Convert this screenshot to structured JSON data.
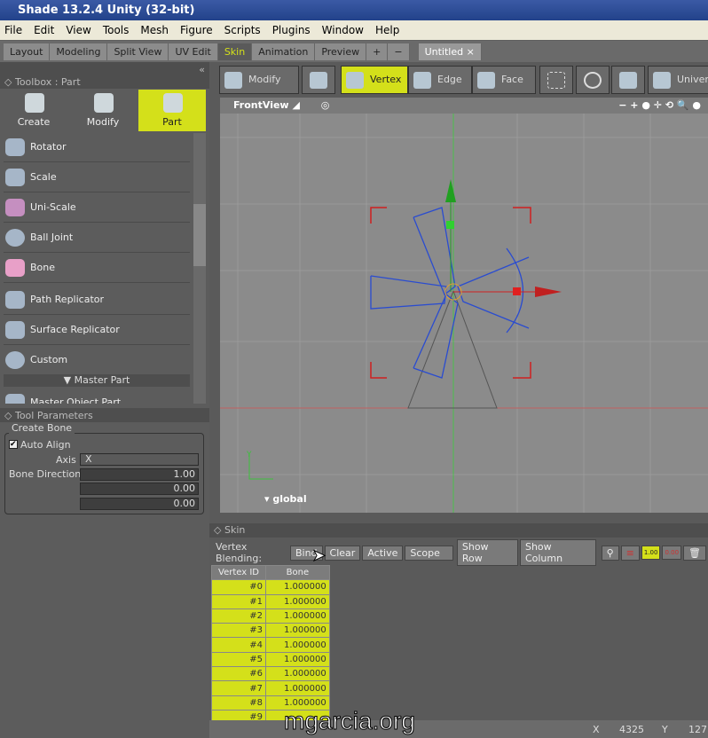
{
  "window": {
    "title": "Shade 13.2.4 Unity (32-bit)"
  },
  "menu": [
    "File",
    "Edit",
    "View",
    "Tools",
    "Mesh",
    "Figure",
    "Scripts",
    "Plugins",
    "Window",
    "Help"
  ],
  "tabs": [
    "Layout",
    "Modeling",
    "Split View",
    "UV Edit",
    "Skin",
    "Animation",
    "Preview"
  ],
  "active_tab": "Skin",
  "tab_add": "+",
  "tab_remove": "−",
  "document_tab": "Untitled",
  "document_close": "×",
  "accent": "#d4e01a",
  "toolbox": {
    "title": "Toolbox : Part",
    "modes": [
      "Create",
      "Modify",
      "Part"
    ],
    "selected_mode": "Part",
    "items": [
      "Rotator",
      "Scale",
      "Uni-Scale",
      "Ball Joint",
      "Bone",
      "Path Replicator",
      "Surface Replicator",
      "Custom"
    ],
    "section": "Master Part",
    "partial_item": "Master Object Part"
  },
  "tool_params": {
    "title": "Tool Parameters",
    "group": "Create Bone",
    "auto_align_label": "Auto Align",
    "auto_align": true,
    "axis_label": "Axis",
    "axis_value": "X",
    "bone_direction_label": "Bone Direction",
    "bone_direction": [
      "1.00",
      "0.00",
      "0.00"
    ]
  },
  "toolbar": {
    "modify": "Modify",
    "vertex": "Vertex",
    "edge": "Edge",
    "face": "Face",
    "universal": "Univers",
    "selected": "Vertex"
  },
  "viewport": {
    "name": "FrontView",
    "space": "global",
    "axis_y": "Y",
    "axis_x": "X"
  },
  "skin": {
    "title": "Skin",
    "vertex_blending_label": "Vertex Blending:",
    "buttons": [
      "Bind",
      "Clear",
      "Active",
      "Scope",
      "Show Row",
      "Show Column"
    ],
    "weight_set": "1.00",
    "weight_clear": "0.00",
    "columns": [
      "Vertex ID",
      "Bone"
    ],
    "rows": [
      [
        "#0",
        "1.000000"
      ],
      [
        "#1",
        "1.000000"
      ],
      [
        "#2",
        "1.000000"
      ],
      [
        "#3",
        "1.000000"
      ],
      [
        "#4",
        "1.000000"
      ],
      [
        "#5",
        "1.000000"
      ],
      [
        "#6",
        "1.000000"
      ],
      [
        "#7",
        "1.000000"
      ],
      [
        "#8",
        "1.000000"
      ],
      [
        "#9",
        ""
      ]
    ]
  },
  "status": {
    "x_label": "X",
    "x_value": "4325",
    "y_label": "Y",
    "y_value": "127"
  },
  "watermark": "mgarcia.org"
}
